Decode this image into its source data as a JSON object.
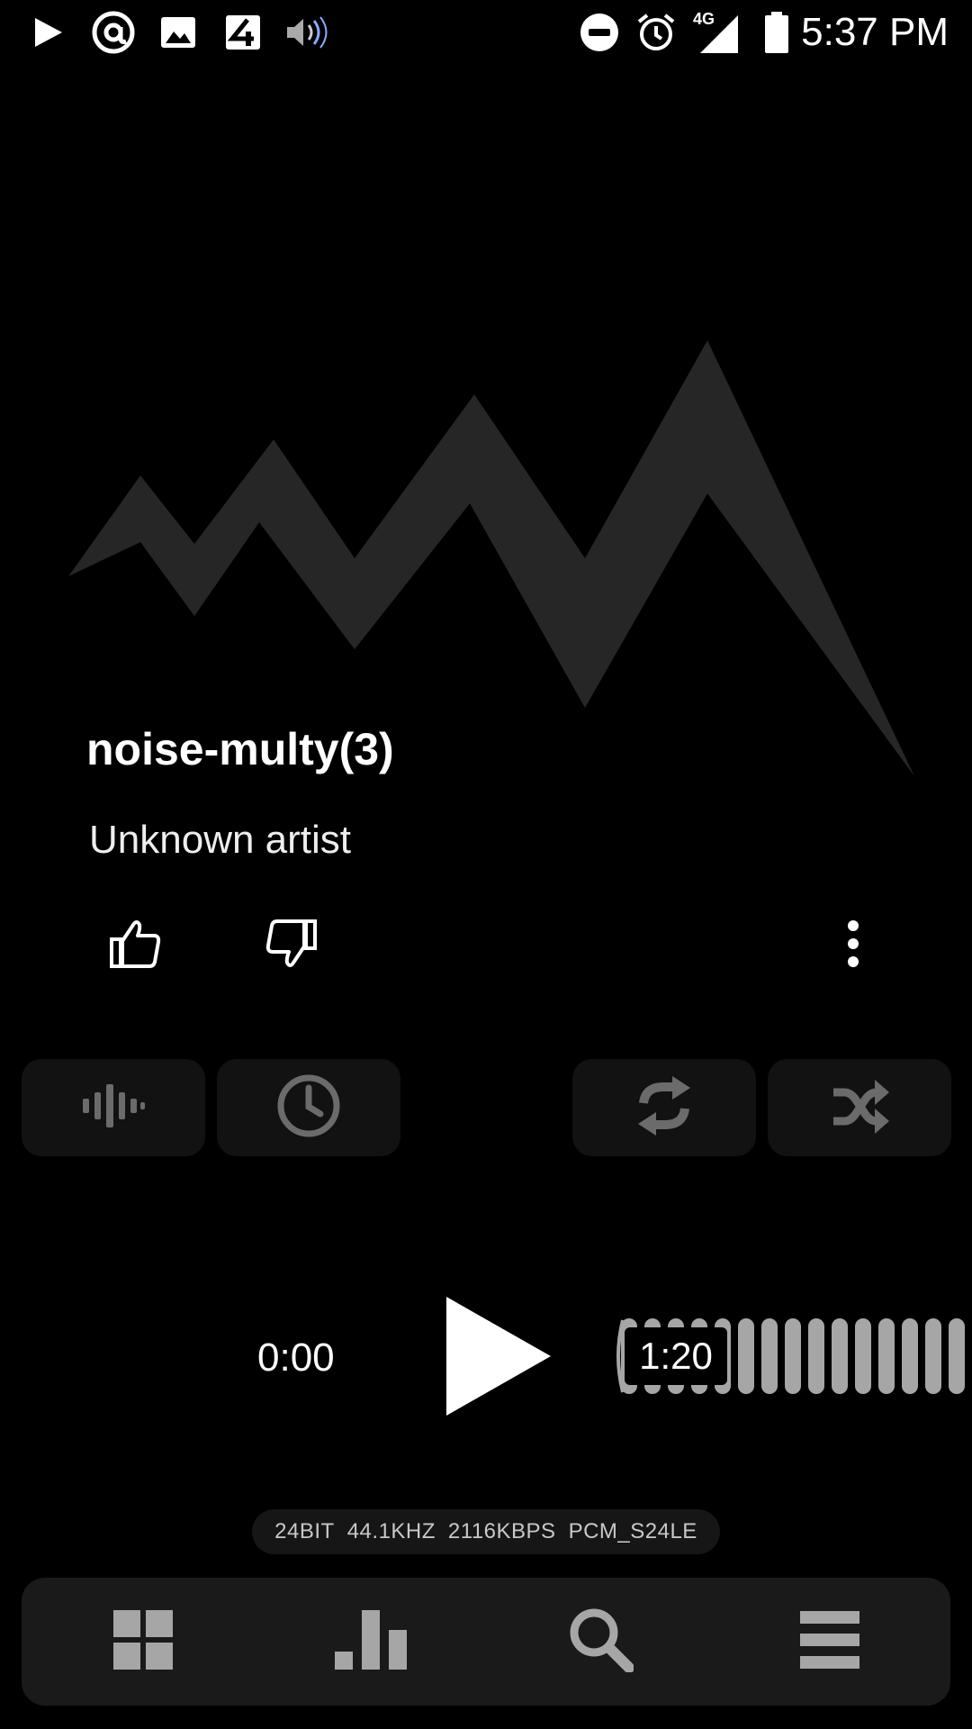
{
  "status_bar": {
    "time": "5:37 PM",
    "network": "4G",
    "icons": [
      "play-icon",
      "at-sign-icon",
      "image-icon",
      "channel-4-icon",
      "speaker-icon",
      "do-not-disturb-icon",
      "alarm-icon",
      "signal-icon",
      "battery-icon"
    ]
  },
  "track": {
    "title": "noise-multy(3)",
    "artist": "Unknown artist"
  },
  "actions": {
    "like_icon": "thumbs-up-icon",
    "dislike_icon": "thumbs-down-icon",
    "more_icon": "more-vertical-icon"
  },
  "tiles": [
    {
      "icon": "waveform-icon"
    },
    {
      "icon": "clock-icon"
    },
    {
      "icon": "repeat-icon"
    },
    {
      "icon": "shuffle-icon"
    }
  ],
  "playback": {
    "current_time": "0:00",
    "total_time": "1:20",
    "progress": 0.0
  },
  "format": {
    "bit_depth": "24BIT",
    "sample_rate": "44.1KHZ",
    "bitrate": "2116KBPS",
    "codec": "PCM_S24LE"
  },
  "bottom_nav": [
    {
      "icon": "grid-icon"
    },
    {
      "icon": "bar-chart-icon"
    },
    {
      "icon": "search-icon"
    },
    {
      "icon": "menu-icon"
    }
  ],
  "colors": {
    "background": "#000000",
    "art": "#262626",
    "tile": "#121212",
    "icon_gray": "#6b6b6b",
    "wave": "#a6a6a6",
    "nav_bg": "#1a1a1a"
  }
}
